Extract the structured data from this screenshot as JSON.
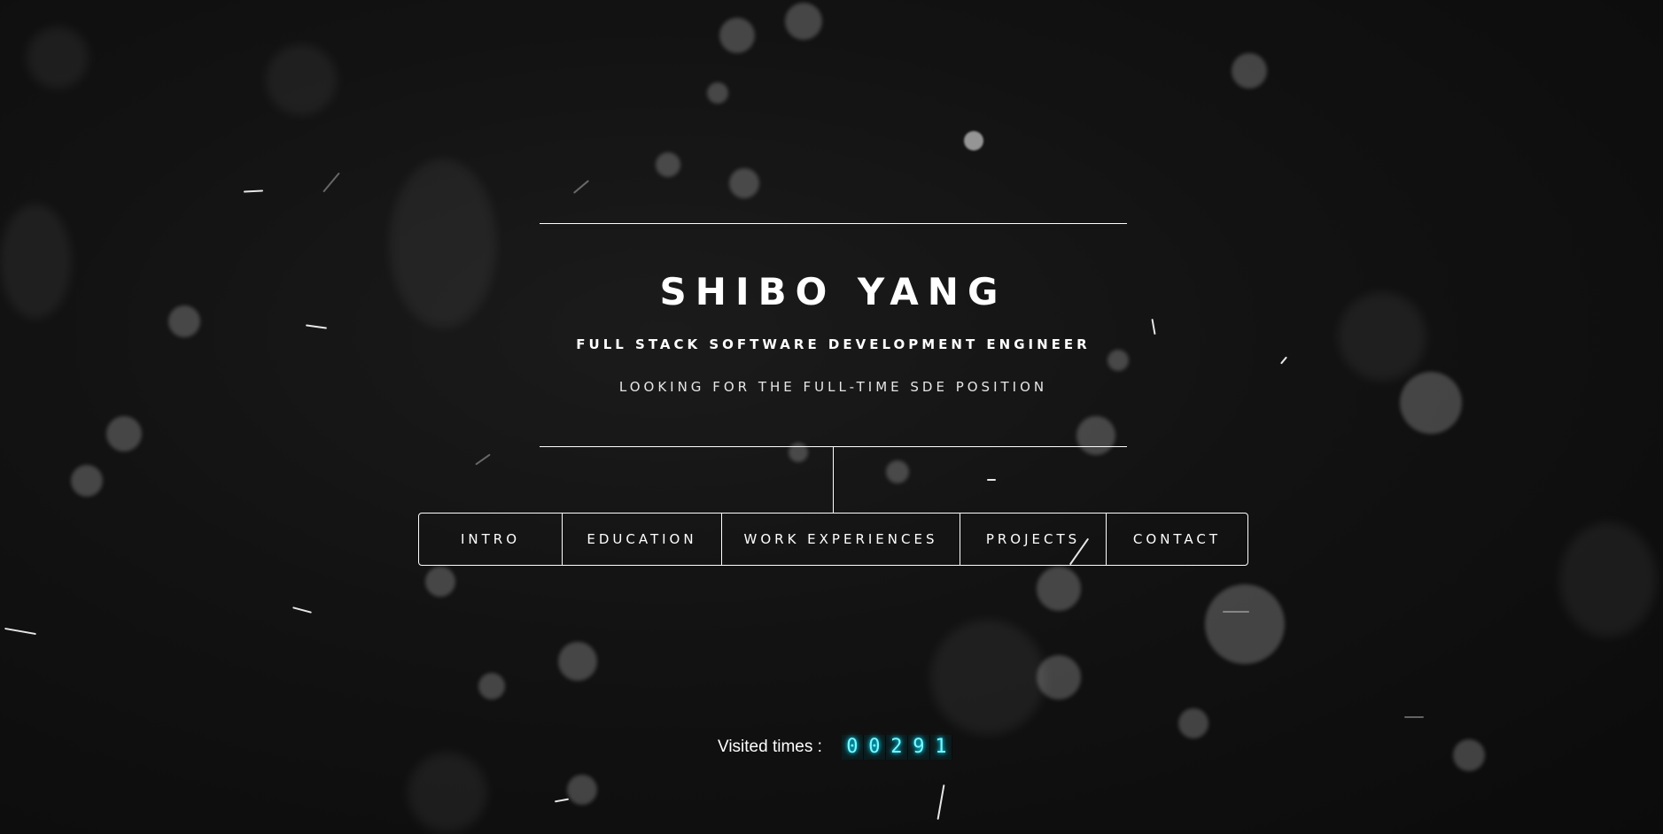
{
  "profile": {
    "name": "SHIBO YANG",
    "title": "FULL STACK SOFTWARE DEVELOPMENT ENGINEER",
    "subtitle": "LOOKING FOR THE FULL-TIME SDE POSITION"
  },
  "nav": {
    "items": [
      {
        "label": "INTRO"
      },
      {
        "label": "EDUCATION"
      },
      {
        "label": "WORK EXPERIENCES"
      },
      {
        "label": "PROJECTS"
      },
      {
        "label": "CONTACT"
      }
    ]
  },
  "visits": {
    "label": "Visited times :",
    "digits": [
      "0",
      "0",
      "2",
      "9",
      "1"
    ]
  },
  "colors": {
    "background": "#0f0f0f",
    "text": "#ffffff",
    "counter_glow": "#00e5ff"
  }
}
